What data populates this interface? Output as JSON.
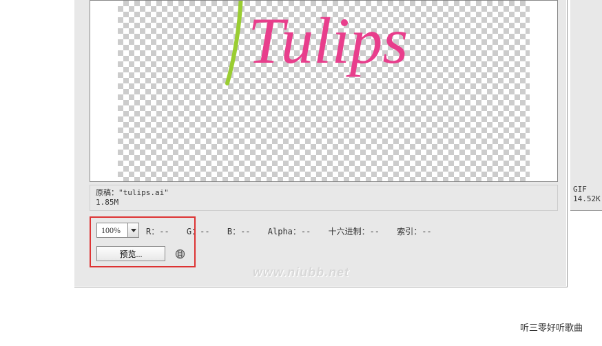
{
  "canvas": {
    "logo_text": "Tulips",
    "logo_color": "#E83E8C",
    "stem_color": "#9ACD32"
  },
  "info": {
    "original_label": "原稿：",
    "filename": "\"tulips.ai\"",
    "size": "1.85M"
  },
  "right": {
    "format": "GIF",
    "size": "14.52K"
  },
  "zoom": {
    "value": "100%"
  },
  "readout": {
    "r": "R：--",
    "g": "G：--",
    "b": "B：--",
    "alpha": "Alpha：--",
    "hex": "十六进制：--",
    "index": "索引：--"
  },
  "buttons": {
    "preview": "预览..."
  },
  "watermark": "www.niubb.net",
  "footer": "听三零好听歌曲"
}
